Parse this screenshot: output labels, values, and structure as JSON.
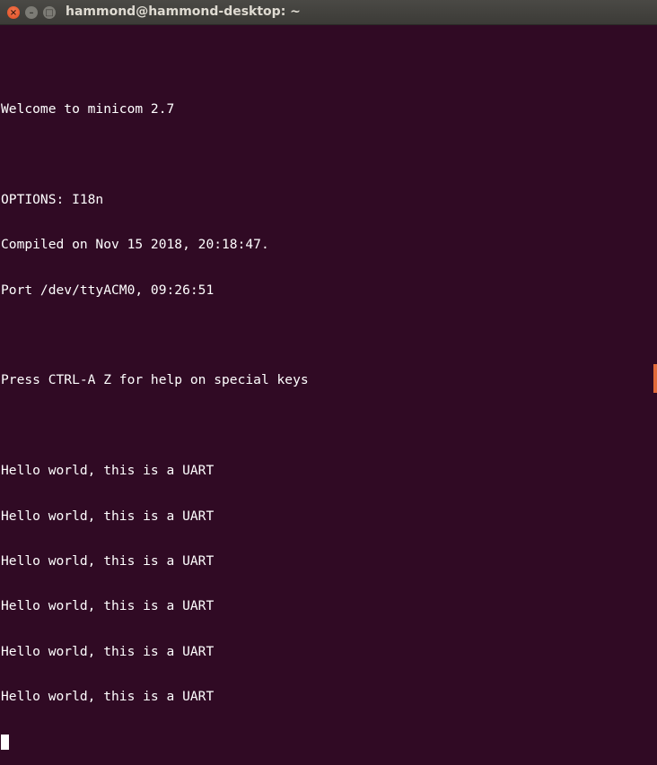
{
  "window": {
    "title": "hammond@hammond-desktop: ~"
  },
  "terminal": {
    "lines": [
      "",
      "Welcome to minicom 2.7",
      "",
      "OPTIONS: I18n",
      "Compiled on Nov 15 2018, 20:18:47.",
      "Port /dev/ttyACM0, 09:26:51",
      "",
      "Press CTRL-A Z for help on special keys",
      "",
      "Hello world, this is a UART",
      "Hello world, this is a UART",
      "Hello world, this is a UART",
      "Hello world, this is a UART",
      "Hello world, this is a UART",
      "Hello world, this is a UART"
    ]
  }
}
